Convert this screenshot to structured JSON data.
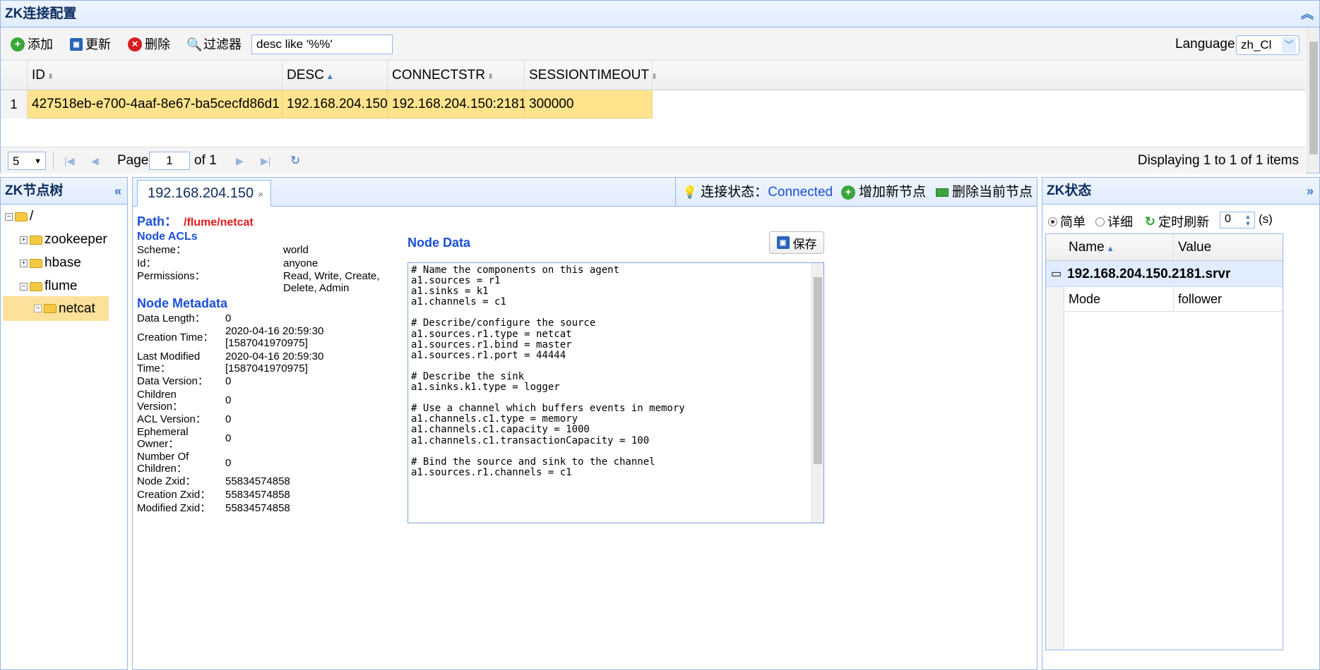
{
  "top": {
    "title": "ZK连接配置",
    "toolbar": {
      "add": "添加",
      "update": "更新",
      "delete": "删除",
      "filter": "过滤器"
    },
    "filter_value": "desc like '%%'",
    "language_label": "Language:",
    "language_value": "zh_Cl",
    "columns": [
      "ID",
      "DESC",
      "CONNECTSTR",
      "SESSIONTIMEOUT"
    ],
    "rows": [
      {
        "num": "1",
        "id": "427518eb-e700-4aaf-8e67-ba5cecfd86d1",
        "desc": "192.168.204.150",
        "connectstr": "192.168.204.150:2181",
        "sessiontimeout": "300000"
      }
    ],
    "pager": {
      "page_size": "5",
      "page_label": "Page",
      "page_value": "1",
      "of_label": "of 1",
      "displaying": "Displaying 1 to 1 of 1 items"
    }
  },
  "tree": {
    "title": "ZK节点树",
    "nodes": {
      "root": "/",
      "zookeeper": "zookeeper",
      "hbase": "hbase",
      "flume": "flume",
      "netcat": "netcat"
    }
  },
  "center": {
    "tab": "192.168.204.150",
    "conn_status_label": "连接状态：",
    "conn_status": "Connected",
    "add_node": "增加新节点",
    "delete_node": "删除当前节点",
    "path_label": "Path：",
    "path_value": "/flume/netcat",
    "acl_title": "Node ACLs",
    "acl": {
      "scheme_label": "Scheme：",
      "scheme": "world",
      "id_label": "Id：",
      "id": "anyone",
      "perm_label": "Permissions：",
      "perm_line1": "Read, Write, Create,",
      "perm_line2": "Delete, Admin"
    },
    "meta_title": "Node Metadata",
    "meta": {
      "data_length_label": "Data Length：",
      "data_length": "0",
      "creation_time_label": "Creation Time：",
      "creation_time_1": "2020-04-16 20:59:30",
      "creation_time_2": "[1587041970975]",
      "last_modified_label_1": "Last Modified",
      "last_modified_label_2": "Time：",
      "last_modified_1": "2020-04-16 20:59:30",
      "last_modified_2": "[1587041970975]",
      "data_version_label": "Data Version：",
      "data_version": "0",
      "children_version_label_1": "Children",
      "children_version_label_2": "Version：",
      "children_version": "0",
      "acl_version_label": "ACL Version：",
      "acl_version": "0",
      "ephemeral_owner_label_1": "Ephemeral",
      "ephemeral_owner_label_2": "Owner：",
      "ephemeral_owner": "0",
      "num_children_label_1": "Number Of",
      "num_children_label_2": "Children：",
      "num_children": "0",
      "node_zxid_label": "Node Zxid：",
      "node_zxid": "55834574858",
      "creation_zxid_label": "Creation Zxid：",
      "creation_zxid": "55834574858",
      "modified_zxid_label": "Modified Zxid：",
      "modified_zxid": "55834574858"
    },
    "data_title": "Node Data",
    "save": "保存",
    "node_data": "# Name the components on this agent\na1.sources = r1\na1.sinks = k1\na1.channels = c1\n\n# Describe/configure the source\na1.sources.r1.type = netcat\na1.sources.r1.bind = master\na1.sources.r1.port = 44444\n\n# Describe the sink\na1.sinks.k1.type = logger\n\n# Use a channel which buffers events in memory\na1.channels.c1.type = memory\na1.channels.c1.capacity = 1000\na1.channels.c1.transactionCapacity = 100\n\n# Bind the source and sink to the channel\na1.sources.r1.channels = c1"
  },
  "status": {
    "title": "ZK状态",
    "simple": "简单",
    "detail": "详细",
    "refresh": "定时刷新",
    "interval": "0",
    "unit": "(s)",
    "col_name": "Name",
    "col_value": "Value",
    "group": "192.168.204.150.2181.srvr",
    "mode_label": "Mode",
    "mode_value": "follower"
  }
}
